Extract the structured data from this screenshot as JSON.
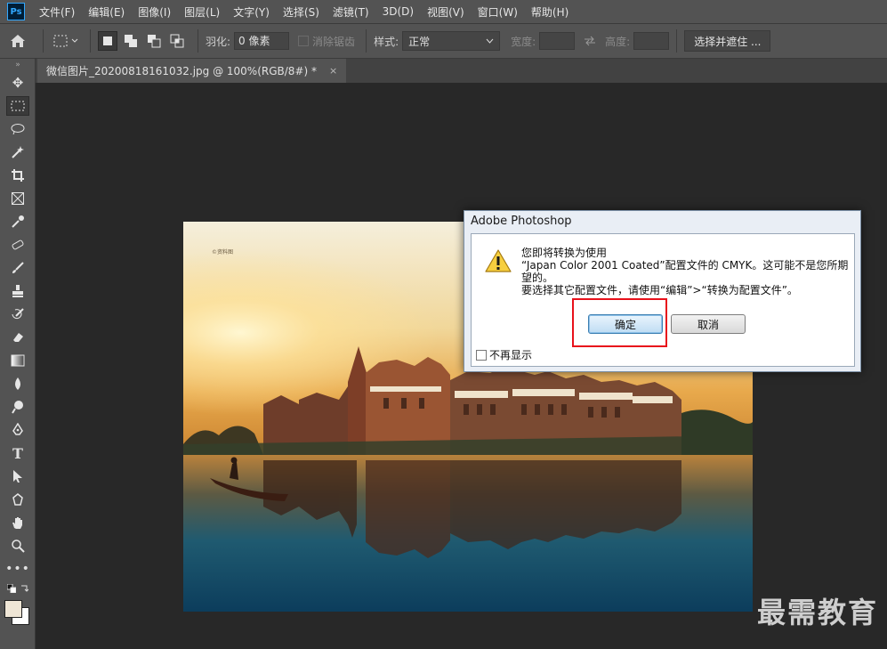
{
  "app": {
    "logo": "Ps",
    "menu": [
      "文件(F)",
      "编辑(E)",
      "图像(I)",
      "图层(L)",
      "文字(Y)",
      "选择(S)",
      "滤镜(T)",
      "3D(D)",
      "视图(V)",
      "窗口(W)",
      "帮助(H)"
    ]
  },
  "options": {
    "feather_label": "羽化:",
    "feather_value": "0 像素",
    "antialias_label": "消除锯齿",
    "style_label": "样式:",
    "style_value": "正常",
    "width_label": "宽度:",
    "height_label": "高度:",
    "select_mask_label": "选择并遮住 ..."
  },
  "document": {
    "tab_title": "微信图片_20200818161032.jpg @ 100%(RGB/8#) *",
    "tab_close": "×",
    "photo_caption": "©资料图"
  },
  "dialog": {
    "title": "Adobe Photoshop",
    "line1": "您即将转换为使用",
    "line2": "“Japan Color 2001 Coated”配置文件的 CMYK。这可能不是您所期望的。",
    "line3": "要选择其它配置文件，请使用“编辑”>“转换为配置文件”。",
    "ok_label": "确定",
    "cancel_label": "取消",
    "dont_show_label": "不再显示"
  },
  "watermark": "最需教育",
  "colors": {
    "accent_highlight": "#e8111b",
    "ps_blue": "#31a8ff",
    "foreground_swatch": "#efe6d6",
    "background_swatch": "#ffffff"
  }
}
